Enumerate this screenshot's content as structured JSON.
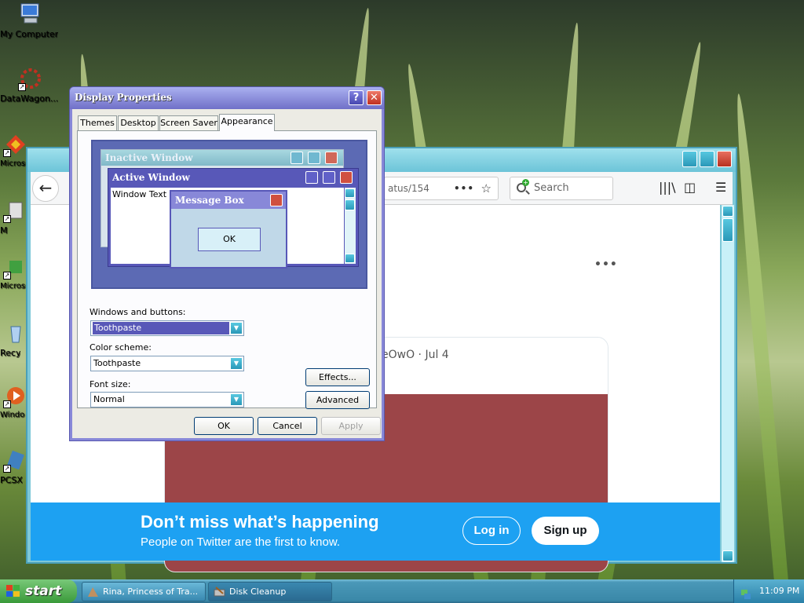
{
  "desktop": {
    "icons": [
      {
        "label": "My Computer",
        "icon": "my-computer-icon",
        "color": "#6aa0e0"
      },
      {
        "label": "DataWagon...",
        "icon": "datawagon-icon",
        "color": "#c03020"
      },
      {
        "label": "Microso C+",
        "icon": "microsoft-cpp-icon",
        "color": "#e04020"
      },
      {
        "label": "M",
        "icon": "app-icon",
        "color": "#808080"
      },
      {
        "label": "Microso Bas",
        "icon": "microsoft-basic-icon",
        "color": "#40a040"
      },
      {
        "label": "Recy",
        "icon": "recycle-bin-icon",
        "color": "#80b0e0"
      },
      {
        "label": "Windo Pla",
        "icon": "windows-player-icon",
        "color": "#e06020"
      },
      {
        "label": "PCSX",
        "icon": "pcsx-icon",
        "color": "#4080c0"
      }
    ]
  },
  "browser": {
    "url_fragment": "atus/154",
    "search_placeholder": "Search",
    "tweet_meta": "eOwO · Jul 4",
    "banner": {
      "heading": "Don’t miss what’s happening",
      "subheading": "People on Twitter are the first to know.",
      "login": "Log in",
      "signup": "Sign up"
    }
  },
  "dialog": {
    "title": "Display Properties",
    "help": "?",
    "close": "✕",
    "tabs": [
      "Themes",
      "Desktop",
      "Screen Saver",
      "Appearance"
    ],
    "active_tab": "Appearance",
    "preview": {
      "inactive_title": "Inactive Window",
      "active_title": "Active Window",
      "window_text": "Window Text",
      "msgbox_title": "Message Box",
      "msgbox_ok": "OK"
    },
    "windows_buttons_label": "Windows and buttons:",
    "windows_buttons_value": "Toothpaste",
    "color_scheme_label": "Color scheme:",
    "color_scheme_value": "Toothpaste",
    "font_size_label": "Font size:",
    "font_size_value": "Normal",
    "effects": "Effects...",
    "advanced": "Advanced",
    "ok": "OK",
    "cancel": "Cancel",
    "apply": "Apply"
  },
  "taskbar": {
    "start": "start",
    "tasks": [
      {
        "label": "Rina, Princess of Tra...",
        "icon": "rina-icon"
      },
      {
        "label": "Disk Cleanup",
        "icon": "disk-cleanup-icon"
      }
    ],
    "clock": "11:09 PM"
  }
}
